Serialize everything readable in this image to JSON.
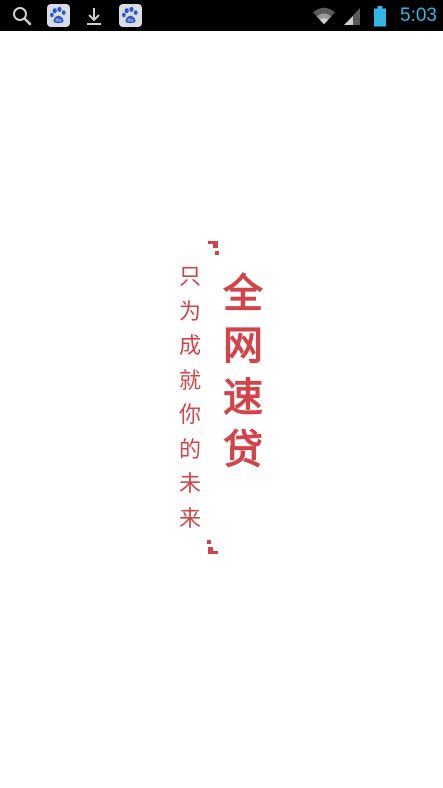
{
  "status_bar": {
    "time": "5:03",
    "left_icons": [
      "search-icon",
      "baidu-paw-icon",
      "download-icon",
      "baidu-paw-icon"
    ],
    "right_icons": [
      "wifi-icon",
      "signal-icon",
      "battery-icon"
    ],
    "accent_color": "#33b5e5"
  },
  "splash": {
    "brand_chars": [
      "全",
      "网",
      "速",
      "贷"
    ],
    "slogan_chars": [
      "只",
      "为",
      "成",
      "就",
      "你",
      "的",
      "未",
      "来"
    ],
    "brand_color": "#d1454a"
  }
}
